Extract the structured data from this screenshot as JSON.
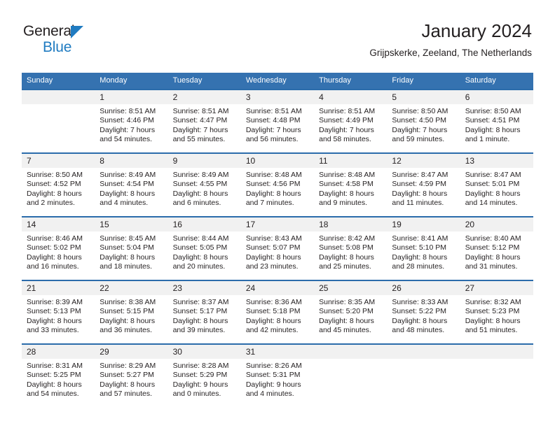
{
  "brand": {
    "line1": "General",
    "line2": "Blue",
    "triangle_icon": "blue-triangle-icon",
    "accent_color": "#1f7bc1"
  },
  "header": {
    "title": "January 2024",
    "subtitle": "Grijpskerke, Zeeland, The Netherlands"
  },
  "colors": {
    "header_blue": "#3572b0",
    "row_rule_blue": "#2b6cab",
    "daynum_band": "#f1f1f1",
    "text": "#231f20"
  },
  "weekday_headers": [
    "Sunday",
    "Monday",
    "Tuesday",
    "Wednesday",
    "Thursday",
    "Friday",
    "Saturday"
  ],
  "weeks": [
    [
      {
        "day": "",
        "lines": []
      },
      {
        "day": "1",
        "lines": [
          "Sunrise: 8:51 AM",
          "Sunset: 4:46 PM",
          "Daylight: 7 hours",
          "and 54 minutes."
        ]
      },
      {
        "day": "2",
        "lines": [
          "Sunrise: 8:51 AM",
          "Sunset: 4:47 PM",
          "Daylight: 7 hours",
          "and 55 minutes."
        ]
      },
      {
        "day": "3",
        "lines": [
          "Sunrise: 8:51 AM",
          "Sunset: 4:48 PM",
          "Daylight: 7 hours",
          "and 56 minutes."
        ]
      },
      {
        "day": "4",
        "lines": [
          "Sunrise: 8:51 AM",
          "Sunset: 4:49 PM",
          "Daylight: 7 hours",
          "and 58 minutes."
        ]
      },
      {
        "day": "5",
        "lines": [
          "Sunrise: 8:50 AM",
          "Sunset: 4:50 PM",
          "Daylight: 7 hours",
          "and 59 minutes."
        ]
      },
      {
        "day": "6",
        "lines": [
          "Sunrise: 8:50 AM",
          "Sunset: 4:51 PM",
          "Daylight: 8 hours",
          "and 1 minute."
        ]
      }
    ],
    [
      {
        "day": "7",
        "lines": [
          "Sunrise: 8:50 AM",
          "Sunset: 4:52 PM",
          "Daylight: 8 hours",
          "and 2 minutes."
        ]
      },
      {
        "day": "8",
        "lines": [
          "Sunrise: 8:49 AM",
          "Sunset: 4:54 PM",
          "Daylight: 8 hours",
          "and 4 minutes."
        ]
      },
      {
        "day": "9",
        "lines": [
          "Sunrise: 8:49 AM",
          "Sunset: 4:55 PM",
          "Daylight: 8 hours",
          "and 6 minutes."
        ]
      },
      {
        "day": "10",
        "lines": [
          "Sunrise: 8:48 AM",
          "Sunset: 4:56 PM",
          "Daylight: 8 hours",
          "and 7 minutes."
        ]
      },
      {
        "day": "11",
        "lines": [
          "Sunrise: 8:48 AM",
          "Sunset: 4:58 PM",
          "Daylight: 8 hours",
          "and 9 minutes."
        ]
      },
      {
        "day": "12",
        "lines": [
          "Sunrise: 8:47 AM",
          "Sunset: 4:59 PM",
          "Daylight: 8 hours",
          "and 11 minutes."
        ]
      },
      {
        "day": "13",
        "lines": [
          "Sunrise: 8:47 AM",
          "Sunset: 5:01 PM",
          "Daylight: 8 hours",
          "and 14 minutes."
        ]
      }
    ],
    [
      {
        "day": "14",
        "lines": [
          "Sunrise: 8:46 AM",
          "Sunset: 5:02 PM",
          "Daylight: 8 hours",
          "and 16 minutes."
        ]
      },
      {
        "day": "15",
        "lines": [
          "Sunrise: 8:45 AM",
          "Sunset: 5:04 PM",
          "Daylight: 8 hours",
          "and 18 minutes."
        ]
      },
      {
        "day": "16",
        "lines": [
          "Sunrise: 8:44 AM",
          "Sunset: 5:05 PM",
          "Daylight: 8 hours",
          "and 20 minutes."
        ]
      },
      {
        "day": "17",
        "lines": [
          "Sunrise: 8:43 AM",
          "Sunset: 5:07 PM",
          "Daylight: 8 hours",
          "and 23 minutes."
        ]
      },
      {
        "day": "18",
        "lines": [
          "Sunrise: 8:42 AM",
          "Sunset: 5:08 PM",
          "Daylight: 8 hours",
          "and 25 minutes."
        ]
      },
      {
        "day": "19",
        "lines": [
          "Sunrise: 8:41 AM",
          "Sunset: 5:10 PM",
          "Daylight: 8 hours",
          "and 28 minutes."
        ]
      },
      {
        "day": "20",
        "lines": [
          "Sunrise: 8:40 AM",
          "Sunset: 5:12 PM",
          "Daylight: 8 hours",
          "and 31 minutes."
        ]
      }
    ],
    [
      {
        "day": "21",
        "lines": [
          "Sunrise: 8:39 AM",
          "Sunset: 5:13 PM",
          "Daylight: 8 hours",
          "and 33 minutes."
        ]
      },
      {
        "day": "22",
        "lines": [
          "Sunrise: 8:38 AM",
          "Sunset: 5:15 PM",
          "Daylight: 8 hours",
          "and 36 minutes."
        ]
      },
      {
        "day": "23",
        "lines": [
          "Sunrise: 8:37 AM",
          "Sunset: 5:17 PM",
          "Daylight: 8 hours",
          "and 39 minutes."
        ]
      },
      {
        "day": "24",
        "lines": [
          "Sunrise: 8:36 AM",
          "Sunset: 5:18 PM",
          "Daylight: 8 hours",
          "and 42 minutes."
        ]
      },
      {
        "day": "25",
        "lines": [
          "Sunrise: 8:35 AM",
          "Sunset: 5:20 PM",
          "Daylight: 8 hours",
          "and 45 minutes."
        ]
      },
      {
        "day": "26",
        "lines": [
          "Sunrise: 8:33 AM",
          "Sunset: 5:22 PM",
          "Daylight: 8 hours",
          "and 48 minutes."
        ]
      },
      {
        "day": "27",
        "lines": [
          "Sunrise: 8:32 AM",
          "Sunset: 5:23 PM",
          "Daylight: 8 hours",
          "and 51 minutes."
        ]
      }
    ],
    [
      {
        "day": "28",
        "lines": [
          "Sunrise: 8:31 AM",
          "Sunset: 5:25 PM",
          "Daylight: 8 hours",
          "and 54 minutes."
        ]
      },
      {
        "day": "29",
        "lines": [
          "Sunrise: 8:29 AM",
          "Sunset: 5:27 PM",
          "Daylight: 8 hours",
          "and 57 minutes."
        ]
      },
      {
        "day": "30",
        "lines": [
          "Sunrise: 8:28 AM",
          "Sunset: 5:29 PM",
          "Daylight: 9 hours",
          "and 0 minutes."
        ]
      },
      {
        "day": "31",
        "lines": [
          "Sunrise: 8:26 AM",
          "Sunset: 5:31 PM",
          "Daylight: 9 hours",
          "and 4 minutes."
        ]
      },
      {
        "day": "",
        "lines": []
      },
      {
        "day": "",
        "lines": []
      },
      {
        "day": "",
        "lines": []
      }
    ]
  ]
}
